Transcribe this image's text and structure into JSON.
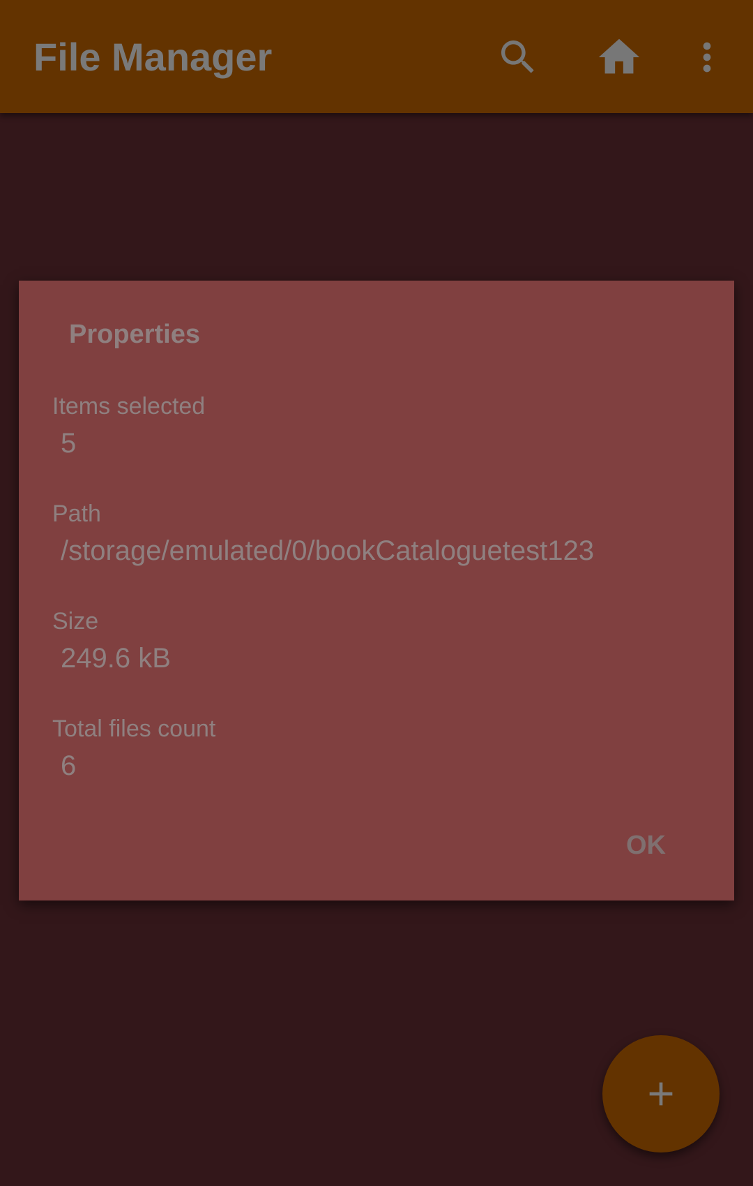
{
  "app_bar": {
    "title": "File Manager",
    "icons": [
      "search-icon",
      "home-icon",
      "more-vert-icon"
    ],
    "background_color": "#633300"
  },
  "dialog": {
    "title": "Properties",
    "properties": [
      {
        "label": "Items selected",
        "value": "5"
      },
      {
        "label": "Path",
        "value": "/storage/emulated/0/bookCataloguetest123"
      },
      {
        "label": "Size",
        "value": "249.6 kB"
      },
      {
        "label": "Total files count",
        "value": "6"
      }
    ],
    "ok_label": "OK",
    "background_color": "#804040"
  },
  "fab": {
    "icon": "plus-icon"
  },
  "colors": {
    "scrim_background": "#33171a",
    "text_muted": "#8f8080"
  }
}
